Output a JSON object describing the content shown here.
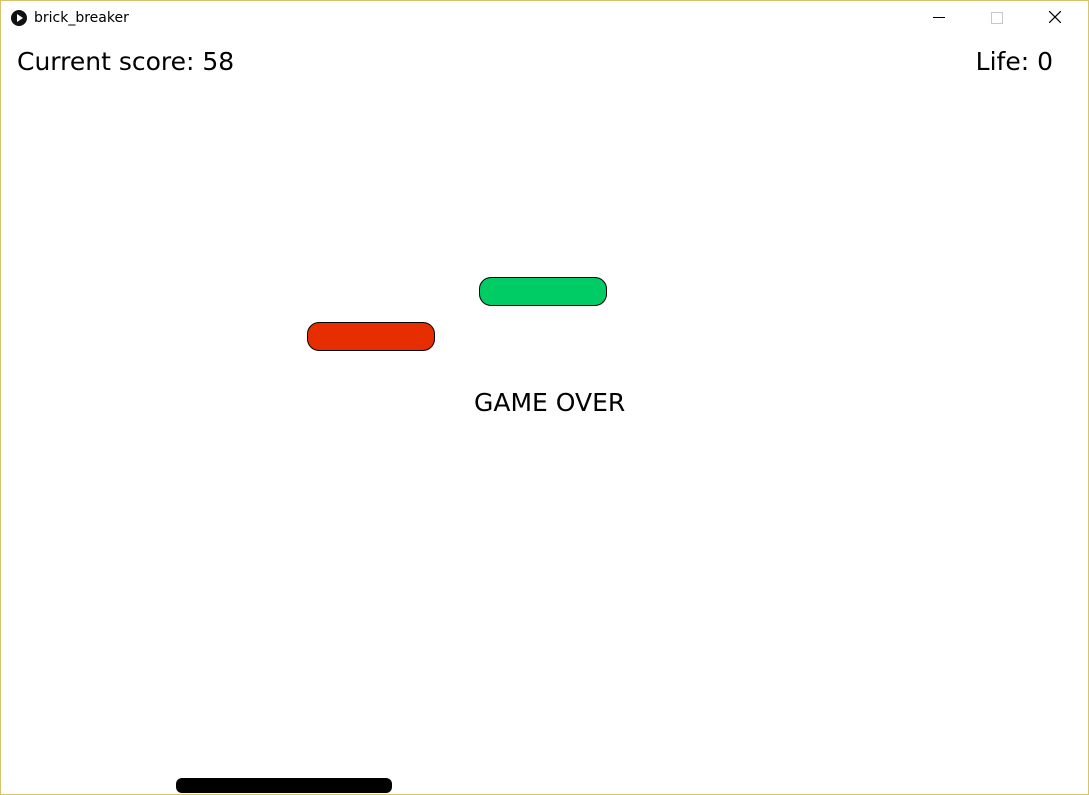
{
  "window": {
    "title": "brick_breaker",
    "border_color": "#d8c36a"
  },
  "titlebar_icons": {
    "app": "play-circle-icon",
    "minimize": "minimize-icon",
    "maximize": "maximize-icon",
    "close": "close-icon"
  },
  "hud": {
    "score_text": "Current score: 58",
    "life_text": "Life: 0"
  },
  "game": {
    "status_text": "GAME OVER",
    "bricks": [
      {
        "color": "#00cc66",
        "name": "green"
      },
      {
        "color": "#e62e00",
        "name": "red"
      }
    ],
    "paddle_color": "#000000"
  }
}
